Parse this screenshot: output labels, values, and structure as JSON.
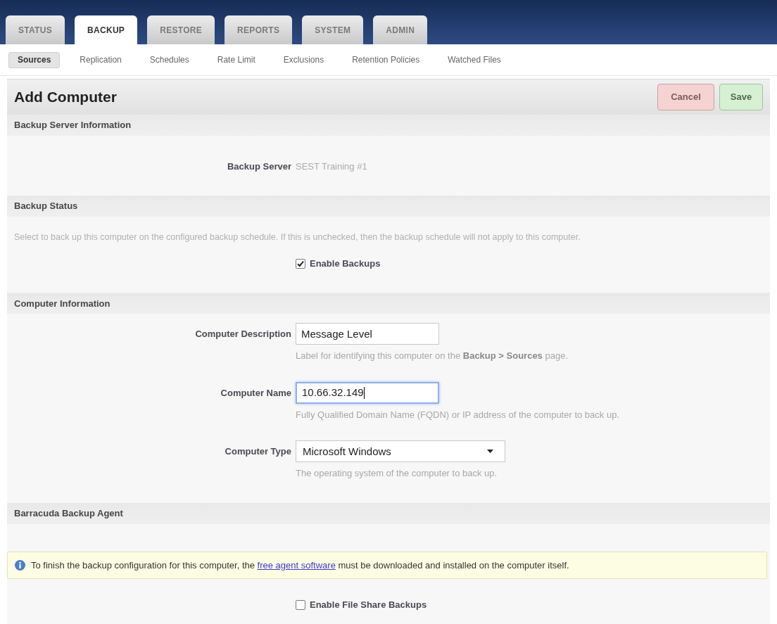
{
  "nav": {
    "tabs": [
      {
        "label": "STATUS",
        "selected": false
      },
      {
        "label": "BACKUP",
        "selected": true
      },
      {
        "label": "RESTORE",
        "selected": false
      },
      {
        "label": "REPORTS",
        "selected": false
      },
      {
        "label": "SYSTEM",
        "selected": false
      },
      {
        "label": "ADMIN",
        "selected": false
      }
    ]
  },
  "subnav": {
    "items": [
      {
        "label": "Sources",
        "selected": true
      },
      {
        "label": "Replication",
        "selected": false
      },
      {
        "label": "Schedules",
        "selected": false
      },
      {
        "label": "Rate Limit",
        "selected": false
      },
      {
        "label": "Exclusions",
        "selected": false
      },
      {
        "label": "Retention Policies",
        "selected": false
      },
      {
        "label": "Watched Files",
        "selected": false
      }
    ]
  },
  "header": {
    "title": "Add Computer",
    "buttons": [
      {
        "label": "Cancel",
        "kind": "cancel"
      },
      {
        "label": "Save",
        "kind": "save"
      }
    ]
  },
  "sections": [
    {
      "title": "Backup Server Information",
      "rows": [
        {
          "kind": "static",
          "label": "Backup Server",
          "value": "SEST Training #1"
        }
      ]
    },
    {
      "title": "Backup Status",
      "rows": [
        {
          "kind": "note",
          "text": "Select to back up this computer on the configured backup schedule. If this is unchecked, then the backup schedule will not apply to this computer."
        },
        {
          "kind": "checkbox",
          "label": "Enable Backups",
          "checked": true
        }
      ]
    },
    {
      "title": "Computer Information",
      "rows": [
        {
          "kind": "text",
          "label": "Computer Description",
          "value": "Message Level",
          "focused": false,
          "hint": "Label for identifying this computer on the **Backup > Sources** page."
        },
        {
          "kind": "text",
          "label": "Computer Name",
          "value": "10.66.32.149",
          "focused": true,
          "hint": "Fully Qualified Domain Name (FQDN) or IP address of the computer to back up."
        },
        {
          "kind": "select",
          "label": "Computer Type",
          "value": "Microsoft Windows",
          "hint": "The operating system of the computer to back up."
        }
      ]
    },
    {
      "title": "Barracuda Backup Agent",
      "rows": [
        {
          "kind": "info",
          "text_before": "To finish the backup configuration for this computer, the",
          "link": "free agent software",
          "text_after": "must be downloaded and installed on the computer itself."
        },
        {
          "kind": "checkbox",
          "label": "Enable File Share Backups",
          "checked": false
        }
      ]
    }
  ]
}
